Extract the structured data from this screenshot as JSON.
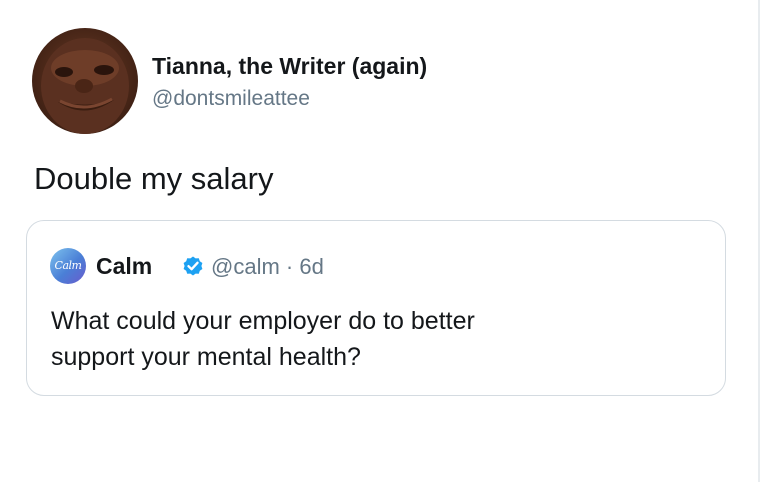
{
  "tweet": {
    "display_name": "Tianna, the Writer (again)",
    "handle": "@dontsmileattee",
    "text": "Double my salary",
    "avatar_icon": "profile-photo"
  },
  "quoted_tweet": {
    "avatar_text": "Calm",
    "display_name": "Calm",
    "verified_icon": "verified-badge-icon",
    "handle_and_time": "@calm · 6d",
    "text_lines": [
      "What could your employer do to better",
      "support your mental health?"
    ]
  },
  "colors": {
    "text": "#14171a",
    "secondary_text": "#657786",
    "verified": "#1da1f2",
    "card_border": "#d4dbe1"
  }
}
